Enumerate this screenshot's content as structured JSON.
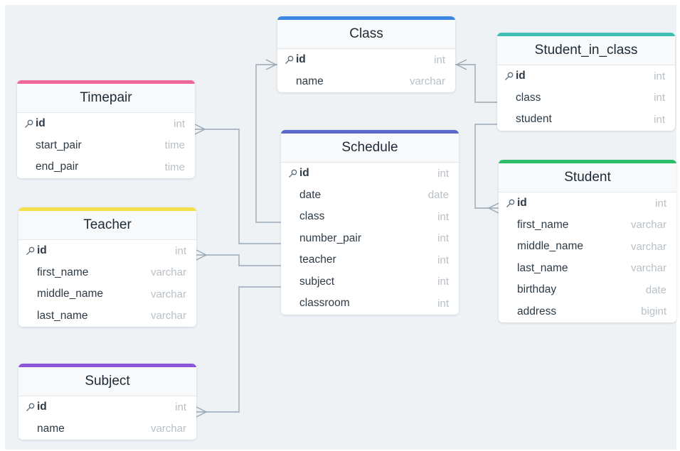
{
  "colors": {
    "canvas": "#eef2f5",
    "connector": "#9aa8b6",
    "class": "#3a86e0",
    "student_in_class": "#3fbfb0",
    "timepair": "#f0679a",
    "schedule": "#5b67c9",
    "student": "#2dbd6a",
    "teacher": "#f5e04a",
    "subject": "#8b55d9"
  },
  "tables": {
    "class": {
      "name": "Class",
      "fields": [
        {
          "name": "id",
          "type": "int"
        },
        {
          "name": "name",
          "type": "varchar"
        }
      ]
    },
    "student_in_class": {
      "name": "Student_in_class",
      "fields": [
        {
          "name": "id",
          "type": "int"
        },
        {
          "name": "class",
          "type": "int"
        },
        {
          "name": "student",
          "type": "int"
        }
      ]
    },
    "timepair": {
      "name": "Timepair",
      "fields": [
        {
          "name": "id",
          "type": "int"
        },
        {
          "name": "start_pair",
          "type": "time"
        },
        {
          "name": "end_pair",
          "type": "time"
        }
      ]
    },
    "schedule": {
      "name": "Schedule",
      "fields": [
        {
          "name": "id",
          "type": "int"
        },
        {
          "name": "date",
          "type": "date"
        },
        {
          "name": "class",
          "type": "int"
        },
        {
          "name": "number_pair",
          "type": "int"
        },
        {
          "name": "teacher",
          "type": "int"
        },
        {
          "name": "subject",
          "type": "int"
        },
        {
          "name": "classroom",
          "type": "int"
        }
      ]
    },
    "student": {
      "name": "Student",
      "fields": [
        {
          "name": "id",
          "type": "int"
        },
        {
          "name": "first_name",
          "type": "varchar"
        },
        {
          "name": "middle_name",
          "type": "varchar"
        },
        {
          "name": "last_name",
          "type": "varchar"
        },
        {
          "name": "birthday",
          "type": "date"
        },
        {
          "name": "address",
          "type": "bigint"
        }
      ]
    },
    "teacher": {
      "name": "Teacher",
      "fields": [
        {
          "name": "id",
          "type": "int"
        },
        {
          "name": "first_name",
          "type": "varchar"
        },
        {
          "name": "middle_name",
          "type": "varchar"
        },
        {
          "name": "last_name",
          "type": "varchar"
        }
      ]
    },
    "subject": {
      "name": "Subject",
      "fields": [
        {
          "name": "id",
          "type": "int"
        },
        {
          "name": "name",
          "type": "varchar"
        }
      ]
    }
  },
  "relationships": [
    {
      "from": "schedule.class",
      "to": "class.id",
      "many_end": "to"
    },
    {
      "from": "student_in_class.class",
      "to": "class.id",
      "many_end": "to"
    },
    {
      "from": "schedule.number_pair",
      "to": "timepair.id",
      "many_end": "to"
    },
    {
      "from": "schedule.teacher",
      "to": "teacher.id",
      "many_end": "to"
    },
    {
      "from": "schedule.subject",
      "to": "subject.id",
      "many_end": "to"
    },
    {
      "from": "student_in_class.student",
      "to": "student.id",
      "many_end": "to"
    }
  ]
}
